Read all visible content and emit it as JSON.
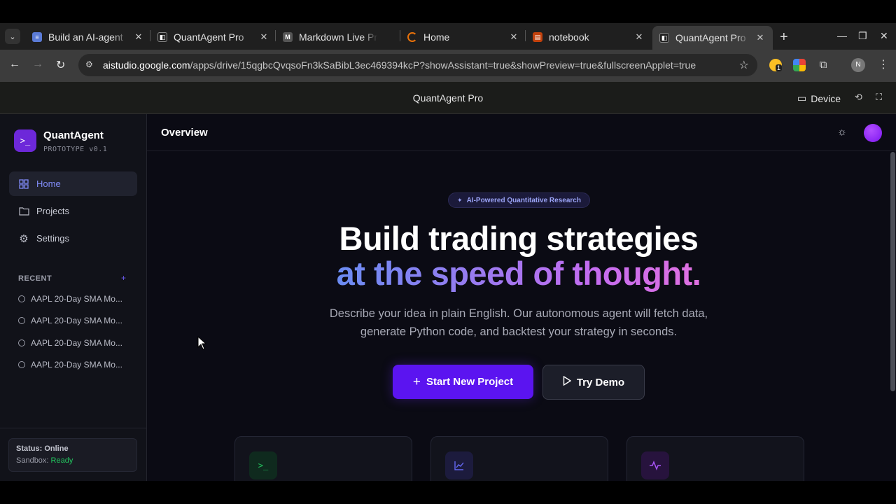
{
  "browser": {
    "tabs": [
      {
        "title": "Build an AI-agent",
        "favicon": "docs-icon",
        "color": "#5b7bd6"
      },
      {
        "title": "QuantAgent Pro",
        "favicon": "aistudio-icon",
        "color": "#222222"
      },
      {
        "title": "Markdown Live Preview",
        "favicon": "markdown-icon",
        "color": "#444444"
      },
      {
        "title": "Home",
        "favicon": "spinner-icon",
        "color": "#e8710a"
      },
      {
        "title": "notebook",
        "favicon": "notebook-icon",
        "color": "#e8710a"
      },
      {
        "title": "QuantAgent Pro",
        "favicon": "aistudio-icon",
        "color": "#222222"
      }
    ],
    "url_host": "aistudio.google.com",
    "url_path": "/apps/drive/15qgbcQvqsoFn3kSaBibL3ec469394kcP?showAssistant=true&showPreview=true&fullscreenApplet=true",
    "profile_initial": "N",
    "extension_badge": "1"
  },
  "studio": {
    "title": "QuantAgent Pro",
    "device_label": "Device"
  },
  "sidebar": {
    "brand": "QuantAgent",
    "version": "PROTOTYPE v0.1",
    "nav": [
      {
        "label": "Home",
        "icon": "grid-icon"
      },
      {
        "label": "Projects",
        "icon": "folder-icon"
      },
      {
        "label": "Settings",
        "icon": "gear-icon"
      }
    ],
    "recent_heading": "RECENT",
    "recent_add": "+",
    "recent": [
      "AAPL 20-Day SMA Mo...",
      "AAPL 20-Day SMA Mo...",
      "AAPL 20-Day SMA Mo...",
      "AAPL 20-Day SMA Mo..."
    ],
    "status_label": "Status: Online",
    "sandbox_label": "Sandbox:",
    "sandbox_value": "Ready"
  },
  "main": {
    "page_title": "Overview",
    "badge": "AI-Powered Quantitative Research",
    "hero_line1": "Build trading strategies",
    "hero_line2": "at the speed of thought.",
    "subtitle": "Describe your idea in plain English. Our autonomous agent will fetch data, generate Python code, and backtest your strategy in seconds.",
    "primary_button": "Start New Project",
    "secondary_button": "Try Demo",
    "cards": [
      {
        "icon": "terminal-icon",
        "color": "#22c55e"
      },
      {
        "icon": "chart-icon",
        "color": "#6366f1"
      },
      {
        "icon": "activity-icon",
        "color": "#a855f7"
      }
    ]
  },
  "colors": {
    "accent": "#5b14f0",
    "brand": "#6d28d9",
    "online": "#22c55e"
  }
}
